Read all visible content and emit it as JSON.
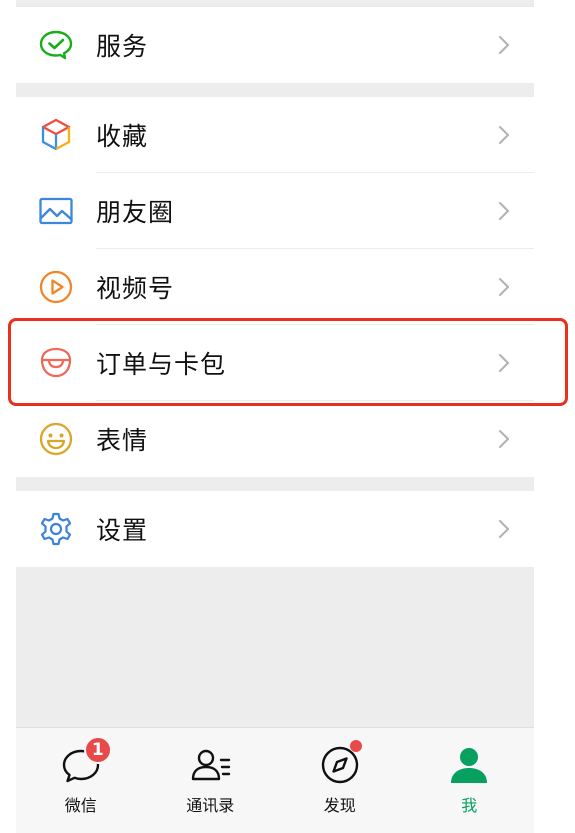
{
  "menu": {
    "group1": [
      {
        "label": "服务",
        "icon": "wechat-pay-service-icon"
      }
    ],
    "group2": [
      {
        "label": "收藏",
        "icon": "favorites-cube-icon"
      },
      {
        "label": "朋友圈",
        "icon": "moments-picture-icon"
      },
      {
        "label": "视频号",
        "icon": "channels-play-icon"
      },
      {
        "label": "订单与卡包",
        "icon": "orders-cards-icon"
      },
      {
        "label": "表情",
        "icon": "sticker-smile-icon"
      }
    ],
    "group3": [
      {
        "label": "设置",
        "icon": "settings-gear-icon"
      }
    ]
  },
  "highlighted_item": "订单与卡包",
  "tabbar": {
    "tabs": [
      {
        "label": "微信",
        "icon": "chat-bubble-icon",
        "badge": "1"
      },
      {
        "label": "通讯录",
        "icon": "contacts-icon"
      },
      {
        "label": "发现",
        "icon": "discover-compass-icon"
      },
      {
        "label": "我",
        "icon": "me-person-icon"
      }
    ],
    "active": "我"
  },
  "colors": {
    "accent_green": "#07a05f",
    "highlight_border": "#e8301c",
    "badge_red": "#e84a4a",
    "background_gray": "#ededed"
  }
}
